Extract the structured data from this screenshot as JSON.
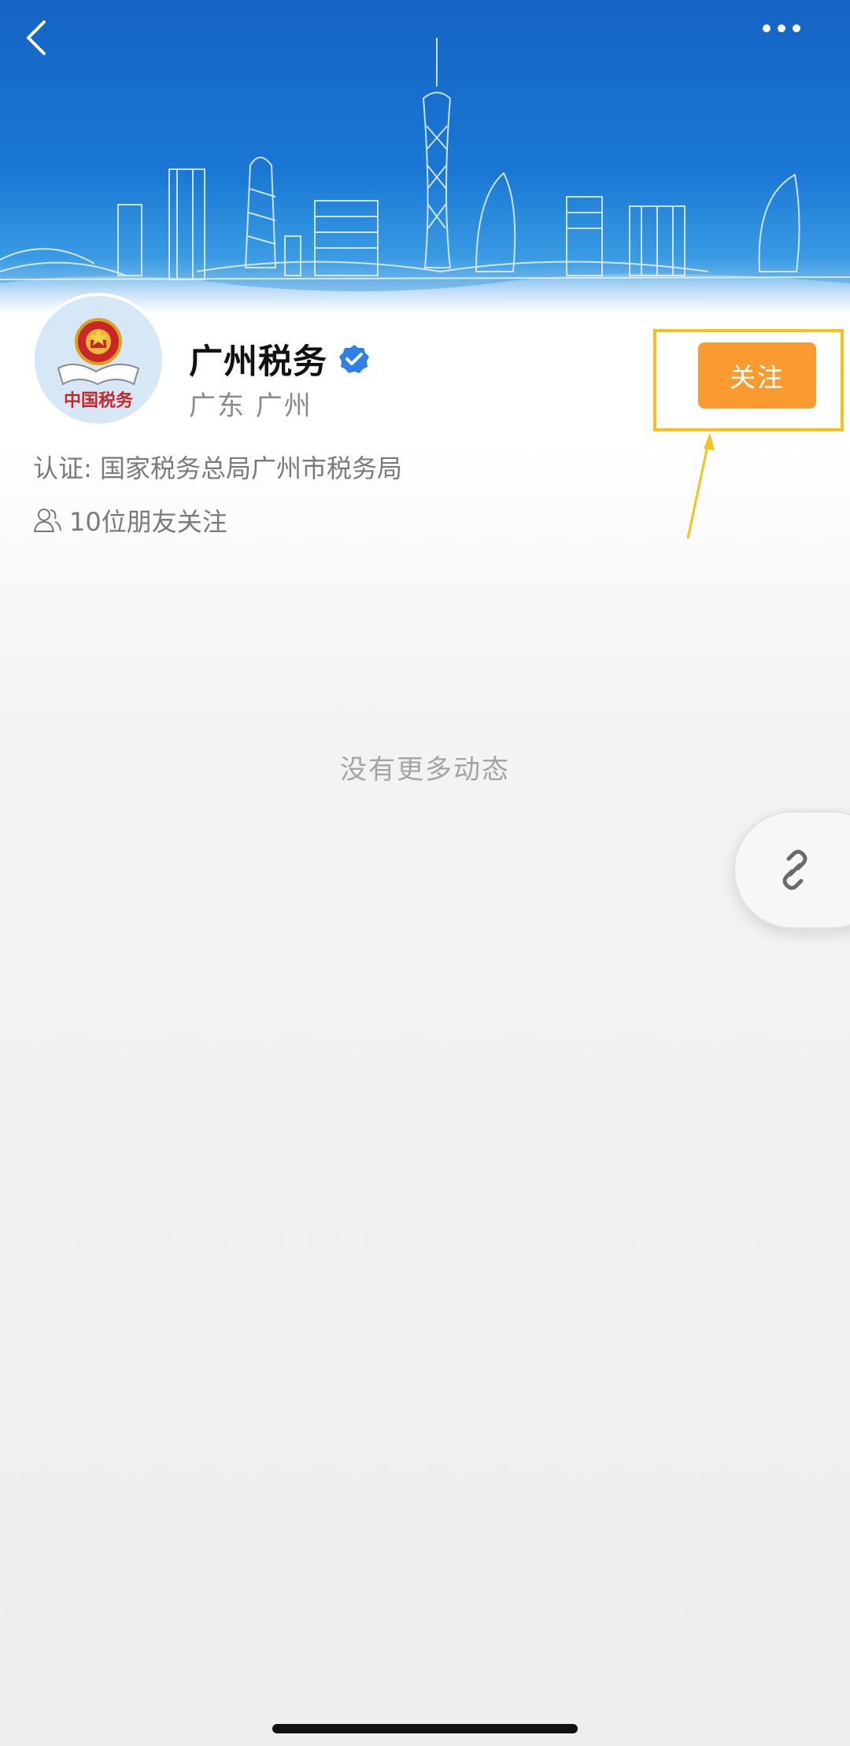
{
  "header": {
    "back_icon": "chevron-left-icon",
    "more_icon": "more-dots-icon"
  },
  "profile": {
    "name": "广州税务",
    "verified_icon": "verified-badge-icon",
    "location": "广东 广州",
    "certification": "认证: 国家税务总局广州市税务局",
    "friends_followed": "10位朋友关注",
    "friends_icon": "friends-icon",
    "avatar_icon": "tax-emblem-icon",
    "avatar_text": "中国税务"
  },
  "actions": {
    "follow_label": "关注"
  },
  "feed": {
    "empty_message": "没有更多动态"
  },
  "fab": {
    "icon": "link-icon"
  },
  "colors": {
    "follow_button": "#f99b31",
    "highlight_border": "#f4c21b",
    "banner_blue": "#1a78d4",
    "verified_blue": "#2f80e6"
  }
}
